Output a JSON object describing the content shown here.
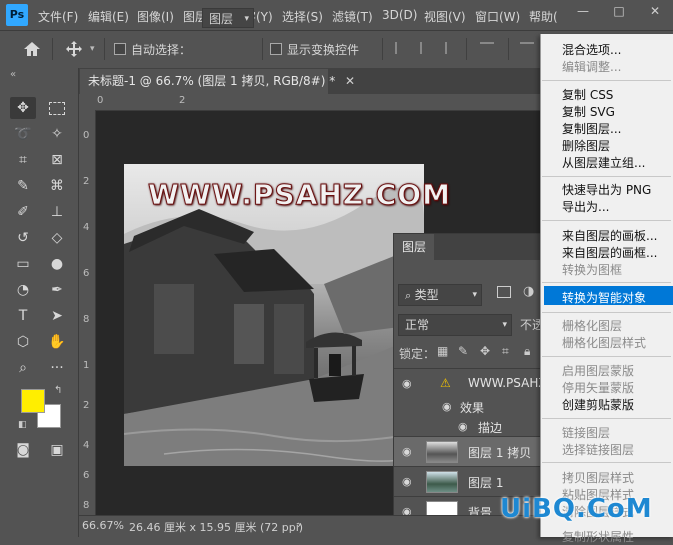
{
  "menubar": {
    "items": [
      "文件(F)",
      "编辑(E)",
      "图像(I)",
      "图层(L)",
      "文字(Y)",
      "选择(S)",
      "滤镜(T)",
      "3D(D)",
      "视图(V)",
      "窗口(W)",
      "帮助("
    ],
    "min": "—",
    "max": "□",
    "close": "✕"
  },
  "options": {
    "auto_select_label": "自动选择：",
    "layer_dropdown": "图层",
    "show_transform_label": "显示变换控件"
  },
  "tabs": {
    "collapse": "«",
    "doc_title": "未标题-1 @ 66.7% (图层 1 拷贝, RGB/8#) *",
    "close": "✕"
  },
  "rulers": {
    "top": [
      "0",
      "2"
    ],
    "left": [
      "0",
      "2",
      "4",
      "6",
      "8",
      "1",
      "2",
      "4",
      "6",
      "8"
    ]
  },
  "canvas": {
    "watermark_text": "WWW.PSAHZ.COM"
  },
  "colors": {
    "foreground": "#ffee00",
    "background": "#ffffff",
    "accent": "#0078d7",
    "logo_blue": "#1e88d2"
  },
  "status": {
    "zoom": "66.67%",
    "doc_size": "26.46 厘米 x 15.95 厘米 (72 ppi)",
    "arrow": "›"
  },
  "layers_panel": {
    "tab_label": "图层",
    "filter_label": "类型",
    "blend_mode": "正常",
    "opacity_label": "不透",
    "lock_label": "锁定：",
    "layers": [
      {
        "name": "WWW.PSAHZ.C",
        "kind": "text"
      },
      {
        "name": "效果",
        "kind": "effect"
      },
      {
        "name": "描边",
        "kind": "effect"
      },
      {
        "name": "图层 1 拷贝",
        "kind": "image"
      },
      {
        "name": "图层 1",
        "kind": "image"
      },
      {
        "name": "背景",
        "kind": "white"
      }
    ]
  },
  "context_menu": {
    "items": [
      {
        "label": "混合选项...",
        "enabled": true
      },
      {
        "label": "编辑调整...",
        "enabled": false
      },
      {
        "label": "复制 CSS",
        "enabled": true
      },
      {
        "label": "复制 SVG",
        "enabled": true
      },
      {
        "label": "复制图层...",
        "enabled": true
      },
      {
        "label": "删除图层",
        "enabled": true
      },
      {
        "label": "从图层建立组...",
        "enabled": true
      },
      {
        "label": "快速导出为 PNG",
        "enabled": true
      },
      {
        "label": "导出为...",
        "enabled": true
      },
      {
        "label": "来自图层的画板...",
        "enabled": true
      },
      {
        "label": "来自图层的画框...",
        "enabled": true
      },
      {
        "label": "转换为图框",
        "enabled": false
      },
      {
        "label": "转换为智能对象",
        "enabled": true,
        "highlighted": true
      },
      {
        "label": "栅格化图层",
        "enabled": false
      },
      {
        "label": "栅格化图层样式",
        "enabled": false
      },
      {
        "label": "启用图层蒙版",
        "enabled": false
      },
      {
        "label": "停用矢量蒙版",
        "enabled": false
      },
      {
        "label": "创建剪贴蒙版",
        "enabled": true
      },
      {
        "label": "链接图层",
        "enabled": false
      },
      {
        "label": "选择链接图层",
        "enabled": false
      },
      {
        "label": "拷贝图层样式",
        "enabled": false
      },
      {
        "label": "粘贴图层样式",
        "enabled": false
      },
      {
        "label": "清除图层样式",
        "enabled": false
      },
      {
        "label": "复制形状属性",
        "enabled": false
      }
    ]
  },
  "site_logo": "UiBQ.CoM"
}
